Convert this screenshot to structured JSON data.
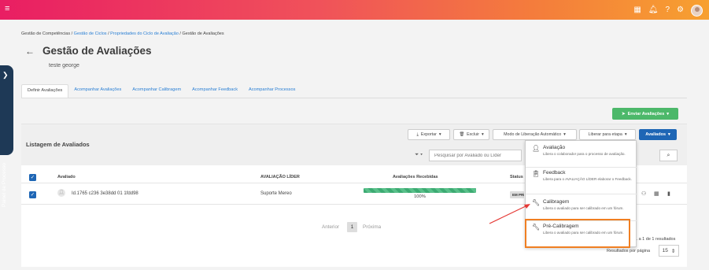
{
  "header": {
    "icons": [
      "grid-icon",
      "bell-icon",
      "help-icon",
      "gear-icon",
      "user-avatar"
    ]
  },
  "breadcrumb": {
    "root": "Gestão de Competências",
    "sep1": " / ",
    "ciclo": "Gestão de Ciclos",
    "sep2": " / ",
    "props": "Propriedades do Ciclo de Avaliação",
    "sep3": " / ",
    "current": "Gestão de Avaliações"
  },
  "page": {
    "title": "Gestão de Avaliações",
    "subtitle": "teste george"
  },
  "side_panel": {
    "label": "Painel de Processo"
  },
  "tabs": [
    {
      "label": "Definir Avaliações"
    },
    {
      "label": "Acompanhar Avaliações"
    },
    {
      "label": "Acompanhar Calibragem"
    },
    {
      "label": "Acompanhar Feedback"
    },
    {
      "label": "Acompanhar Processos"
    }
  ],
  "actions": {
    "send": "Enviar Avaliações",
    "export": "Exportar",
    "delete": "Excluir",
    "release_mode": "Modo de Liberação Automático",
    "release_stage": "Liberar para etapa",
    "evaluated": "Avaliados"
  },
  "list": {
    "title": "Listagem de Avaliados",
    "search_placeholder": "Pesquisar por Avaliado ou Líder",
    "columns": {
      "evaluated": "Avaliado",
      "leader": "AVALIAÇÃO LÍDER",
      "received": "Avaliações Recebidas",
      "status": "Status"
    },
    "rows": [
      {
        "name": "Id.1765 c236 3e38dd 01 1fdd98",
        "leader": "Suporte Mereo",
        "progress": "100%",
        "progress_fraction": 1.0,
        "status": "EM PRE"
      }
    ]
  },
  "pagination": {
    "prev": "Anterior",
    "page": "1",
    "next": "Próxima",
    "results": "1 a 1 de 1 resultados",
    "per_page_label": "Resultados por página",
    "per_page_value": "15"
  },
  "dropdown": {
    "items": [
      {
        "title": "Avaliação",
        "desc": "Libera o colaborador para o processo de avaliação.",
        "icon": "user-edit-icon"
      },
      {
        "title": "Feedback",
        "desc": "Libera para o AVALIAÇÃO LÍDER elaborar o Feedback.",
        "icon": "clipboard-icon"
      },
      {
        "title": "Calibragem",
        "desc": "Libera o avaliado para ser calibrado em um fórum.",
        "icon": "wrench-icon"
      },
      {
        "title": "Pré-Calibragem",
        "desc": "Libera o avaliado para ser calibrado em um fórum.",
        "icon": "wrench-icon"
      }
    ]
  },
  "colors": {
    "brand_gradient_start": "#e91e63",
    "brand_gradient_end": "#f7a030",
    "primary": "#1e66b5",
    "success": "#4cb86a",
    "highlight": "#f07f22",
    "annotation_arrow": "#e53935"
  }
}
